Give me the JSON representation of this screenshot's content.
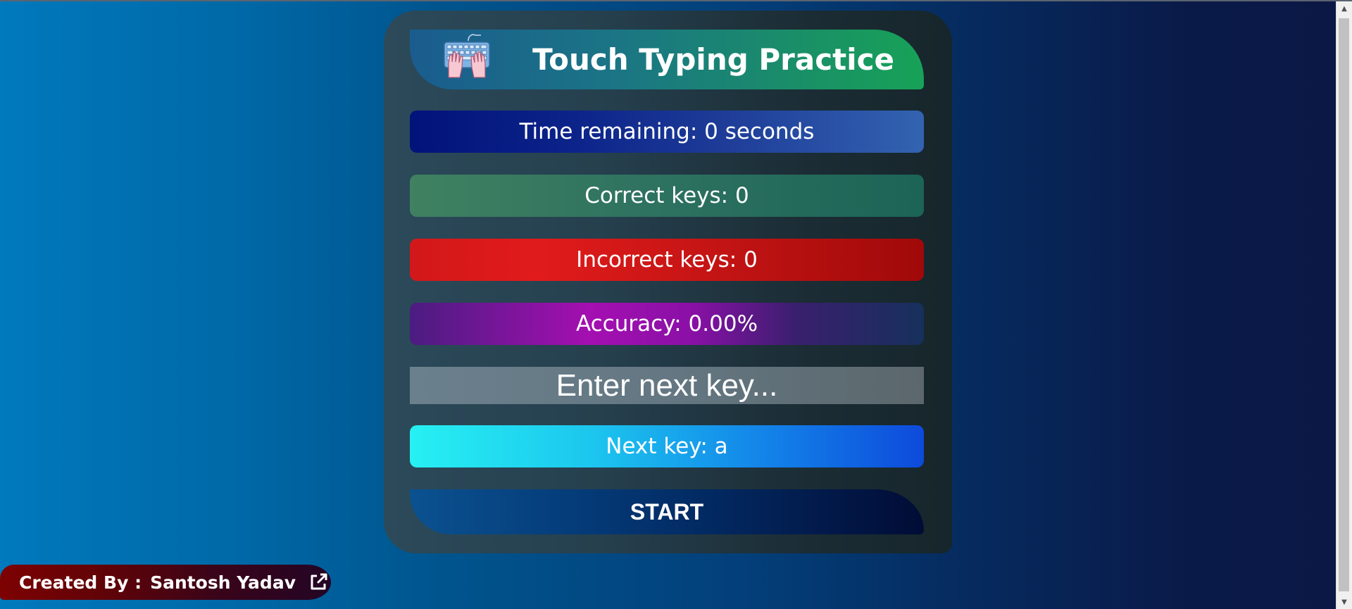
{
  "app": {
    "title": "Touch Typing Practice",
    "logo_icon": "keyboard-hands-icon"
  },
  "stats": {
    "time_remaining": "Time remaining: 0 seconds",
    "correct_keys": "Correct keys: 0",
    "incorrect_keys": "Incorrect keys: 0",
    "accuracy": "Accuracy: 0.00%"
  },
  "input": {
    "placeholder": "Enter next key...",
    "value": ""
  },
  "next_key": "Next key: a",
  "start_label": "START",
  "credit": {
    "label": "Created By :",
    "name": "Santosh Yadav",
    "link_icon": "external-link-icon"
  },
  "colors": {
    "background_left": "#0079bd",
    "background_right": "#0b1846",
    "header_green": "#17a257",
    "incorrect_red": "#e11b1b",
    "accuracy_magenta": "#a40fb1",
    "next_key_cyan": "#27f0f2"
  }
}
